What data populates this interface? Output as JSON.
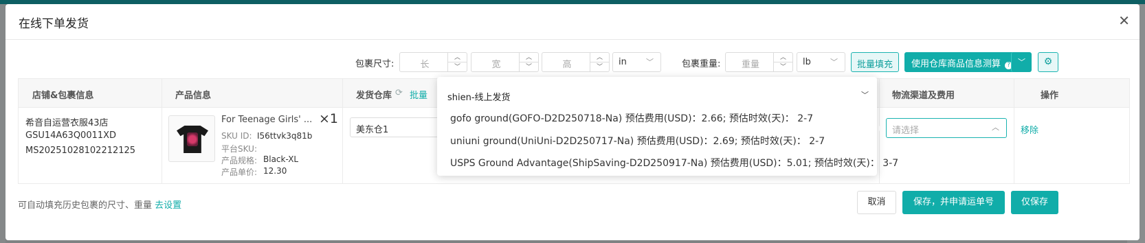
{
  "modal": {
    "title": "在线下单发货",
    "close_icon": "close-icon"
  },
  "toolbar": {
    "size_label": "包裹尺寸:",
    "length_placeholder": "长",
    "width_placeholder": "宽",
    "height_placeholder": "高",
    "size_unit": "in",
    "weight_label": "包裹重量:",
    "weight_placeholder": "重量",
    "weight_unit": "lb",
    "batch_fill_label": "批量填充",
    "estimate_label": "使用仓库商品信息测算",
    "settings_icon": "gear-icon"
  },
  "table": {
    "headers": {
      "store": "店铺&包裹信息",
      "product": "产品信息",
      "warehouse": "发货仓库",
      "batch": "批量",
      "channel": "物流渠道及费用",
      "action": "操作"
    },
    "row": {
      "store_name": "希音自运营衣服43店",
      "package_no": "GSU14A63Q0011XD",
      "order_no": "MS20251028102212125",
      "product_title": "For Teenage Girls' ...",
      "quantity": "×1",
      "sku_label": "SKU ID:",
      "sku_value": "I56ttvk3q81b",
      "platform_sku_label": "平台SKU:",
      "spec_label": "产品规格:",
      "spec_value": "Black-XL",
      "price_label": "产品单价:",
      "price_value": "12.30",
      "warehouse_value": "美东仓1",
      "channel_placeholder": "请选择",
      "remove_label": "移除"
    }
  },
  "dropdown": {
    "group_label": "shien-线上发货",
    "options": [
      "gofo ground(GOFO-D2D250718-Na) 预估费用(USD)：2.66; 预估时效(天)： 2-7",
      "uniuni ground(UniUni-D2D250717-Na) 预估费用(USD)：2.69; 预估时效(天)： 2-7",
      "USPS Ground Advantage(ShipSaving-D2D250917-Na) 预估费用(USD)：5.01; 预估时效(天)： 3-7"
    ]
  },
  "footer": {
    "note": "可自动填充历史包裹的尺寸、重量",
    "settings_link": "去设置",
    "cancel_label": "取消",
    "save_and_apply_label": "保存，并申请运单号",
    "save_only_label": "仅保存"
  },
  "colors": {
    "primary": "#11ada9",
    "border": "#dcdcdc"
  }
}
